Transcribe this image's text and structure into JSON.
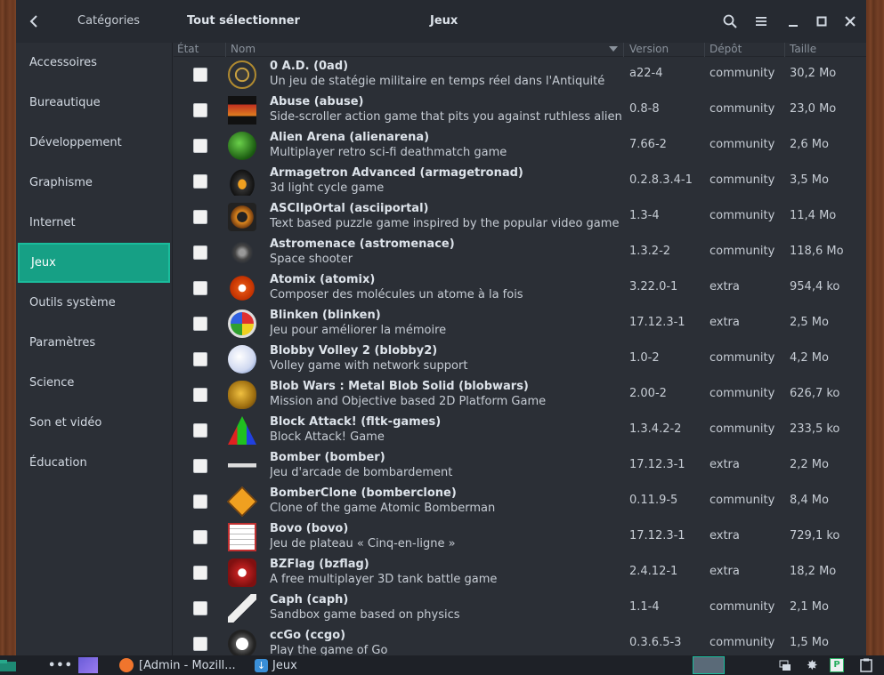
{
  "header": {
    "categories_label": "Catégories",
    "select_all_label": "Tout sélectionner",
    "title": "Jeux"
  },
  "sidebar": {
    "items": [
      {
        "label": "Accessoires"
      },
      {
        "label": "Bureautique"
      },
      {
        "label": "Développement"
      },
      {
        "label": "Graphisme"
      },
      {
        "label": "Internet"
      },
      {
        "label": "Jeux",
        "active": true
      },
      {
        "label": "Outils système"
      },
      {
        "label": "Paramètres"
      },
      {
        "label": "Science"
      },
      {
        "label": "Son et vidéo"
      },
      {
        "label": "Éducation"
      }
    ]
  },
  "columns": {
    "state": "État",
    "name": "Nom",
    "version": "Version",
    "repo": "Dépôt",
    "size": "Taille"
  },
  "packages": [
    {
      "name": "0 A.D.  (0ad)",
      "desc": "Un jeu de statégie militaire en temps réel dans l'Antiquité",
      "version": "a22-4",
      "repo": "community",
      "size": "30,2 Mo",
      "icon": "0ad-icon"
    },
    {
      "name": "Abuse  (abuse)",
      "desc": "Side-scroller action game that pits you against ruthless alien killers",
      "version": "0.8-8",
      "repo": "community",
      "size": "23,0 Mo",
      "icon": "abuse-icon"
    },
    {
      "name": "Alien Arena  (alienarena)",
      "desc": "Multiplayer retro sci-fi deathmatch game",
      "version": "7.66-2",
      "repo": "community",
      "size": "2,6 Mo",
      "icon": "alienarena-icon"
    },
    {
      "name": "Armagetron Advanced  (armagetronad)",
      "desc": "3d light cycle game",
      "version": "0.2.8.3.4-1",
      "repo": "community",
      "size": "3,5 Mo",
      "icon": "armagetron-icon"
    },
    {
      "name": "ASCIIpOrtal  (asciiportal)",
      "desc": "Text based puzzle game inspired by the popular video game",
      "version": "1.3-4",
      "repo": "community",
      "size": "11,4 Mo",
      "icon": "asciiportal-icon"
    },
    {
      "name": "Astromenace  (astromenace)",
      "desc": "Space shooter",
      "version": "1.3.2-2",
      "repo": "community",
      "size": "118,6 Mo",
      "icon": "astromenace-icon"
    },
    {
      "name": "Atomix  (atomix)",
      "desc": "Composer des molécules un atome à la fois",
      "version": "3.22.0-1",
      "repo": "extra",
      "size": "954,4 ko",
      "icon": "atomix-icon"
    },
    {
      "name": "Blinken  (blinken)",
      "desc": "Jeu pour améliorer la mémoire",
      "version": "17.12.3-1",
      "repo": "extra",
      "size": "2,5 Mo",
      "icon": "blinken-icon"
    },
    {
      "name": "Blobby Volley 2  (blobby2)",
      "desc": "Volley game with network support",
      "version": "1.0-2",
      "repo": "community",
      "size": "4,2 Mo",
      "icon": "blobby-icon"
    },
    {
      "name": "Blob Wars : Metal Blob Solid  (blobwars)",
      "desc": "Mission and Objective based 2D Platform Game",
      "version": "2.00-2",
      "repo": "community",
      "size": "626,7 ko",
      "icon": "blobwars-icon"
    },
    {
      "name": "Block Attack!  (fltk-games)",
      "desc": "Block Attack! Game",
      "version": "1.3.4.2-2",
      "repo": "community",
      "size": "233,5 ko",
      "icon": "blockattack-icon"
    },
    {
      "name": "Bomber  (bomber)",
      "desc": "Jeu d'arcade de bombardement",
      "version": "17.12.3-1",
      "repo": "extra",
      "size": "2,2 Mo",
      "icon": "bomber-icon"
    },
    {
      "name": "BomberClone  (bomberclone)",
      "desc": "Clone of the game Atomic Bomberman",
      "version": "0.11.9-5",
      "repo": "community",
      "size": "8,4 Mo",
      "icon": "bomberclone-icon"
    },
    {
      "name": "Bovo  (bovo)",
      "desc": "Jeu de plateau « Cinq-en-ligne »",
      "version": "17.12.3-1",
      "repo": "extra",
      "size": "729,1 ko",
      "icon": "bovo-icon"
    },
    {
      "name": "BZFlag  (bzflag)",
      "desc": "A free multiplayer 3D tank battle game",
      "version": "2.4.12-1",
      "repo": "extra",
      "size": "18,2 Mo",
      "icon": "bzflag-icon"
    },
    {
      "name": "Caph  (caph)",
      "desc": "Sandbox game based on physics",
      "version": "1.1-4",
      "repo": "community",
      "size": "2,1 Mo",
      "icon": "caph-icon"
    },
    {
      "name": "ccGo  (ccgo)",
      "desc": "Play the game of Go",
      "version": "0.3.6.5-3",
      "repo": "community",
      "size": "1,5 Mo",
      "icon": "ccgo-icon"
    }
  ],
  "taskbar": {
    "firefox_label": "[Admin - Mozill...",
    "pamac_label": "Jeux"
  }
}
